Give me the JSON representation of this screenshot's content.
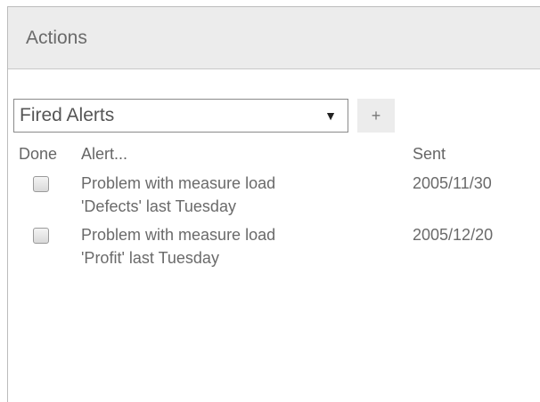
{
  "panel": {
    "title": "Actions"
  },
  "filter": {
    "selected": "Fired Alerts",
    "add_label": "+"
  },
  "table": {
    "columns": {
      "done": "Done",
      "alert": "Alert...",
      "sent": "Sent"
    },
    "rows": [
      {
        "done": false,
        "alert_line1": "Problem with measure load",
        "alert_line2": "'Defects' last Tuesday",
        "sent": "2005/11/30"
      },
      {
        "done": false,
        "alert_line1": "Problem with measure load",
        "alert_line2": "'Profit' last Tuesday",
        "sent": "2005/12/20"
      }
    ]
  },
  "icons": {
    "dropdown": "chevron-down-icon"
  }
}
